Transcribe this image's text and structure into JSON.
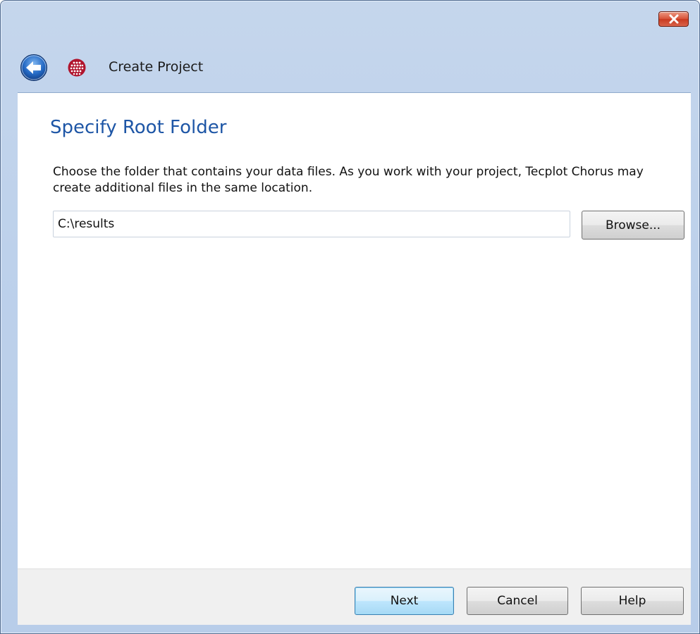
{
  "window": {
    "title": "Create Project",
    "close_icon": "close-icon",
    "back_icon": "back-arrow-icon",
    "app_icon": "tecplot-chorus-logo",
    "colors": {
      "accent_heading": "#1e56a6",
      "titlebar": "#bdd1eb",
      "close_button": "#d9543a"
    }
  },
  "page": {
    "heading": "Specify Root Folder",
    "description": "Choose the folder that contains your data files. As you work with your project, Tecplot Chorus may create additional files in the same location.",
    "folder_path": "C:\\results",
    "browse_label": "Browse..."
  },
  "footer": {
    "next_label": "Next",
    "cancel_label": "Cancel",
    "help_label": "Help"
  }
}
